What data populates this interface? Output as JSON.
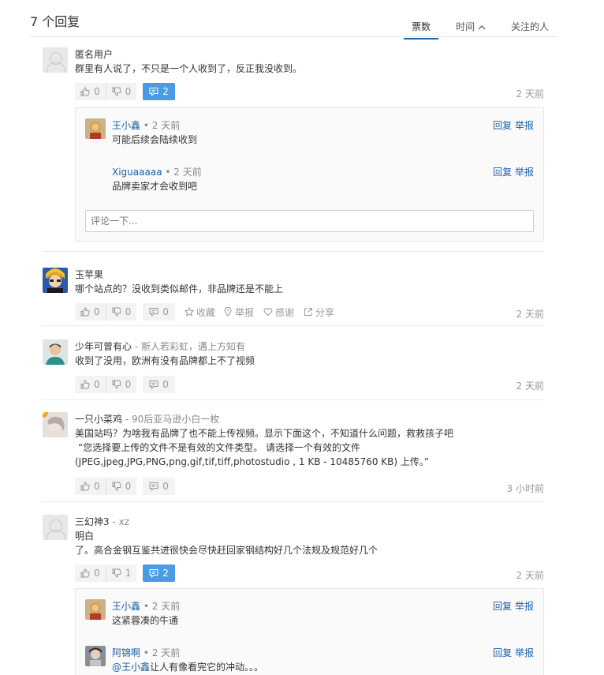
{
  "header": {
    "count_label": "7 个回复",
    "sort_tabs": [
      {
        "label": "票数",
        "active": true
      },
      {
        "label": "时间",
        "active": false
      },
      {
        "label": "关注的人",
        "active": false
      }
    ]
  },
  "answers": [
    {
      "user": "匿名用户",
      "title": "",
      "lines": [
        "群里有人说了，不只是一个人收到了，反正我没收到。"
      ],
      "up": "0",
      "down": "0",
      "comments": "2",
      "time": "2 天前",
      "comment_list": [
        {
          "user": "王小鑫",
          "time": "2 天前",
          "text": "可能后续会陆续收到",
          "reply": "回复",
          "report": "举报"
        },
        {
          "user": "Xiguaaaaa",
          "time": "2 天前",
          "text": "品牌卖家才会收到吧",
          "reply": "回复",
          "report": "举报"
        }
      ],
      "comment_placeholder": "评论一下..."
    },
    {
      "user": "玉苹果",
      "title": "",
      "lines": [
        "哪个站点的？没收到类似邮件，非品牌还是不能上"
      ],
      "up": "0",
      "down": "0",
      "comments": "0",
      "time": "2 天前",
      "extras": {
        "favorite": "收藏",
        "report": "举报",
        "thanks": "感谢",
        "share": "分享"
      }
    },
    {
      "user": "少年可曾有心",
      "title": "斯人若彩虹，遇上方知有",
      "lines": [
        "收到了没用，欧洲有没有品牌都上不了视频"
      ],
      "up": "0",
      "down": "0",
      "comments": "0",
      "time": "2 天前"
    },
    {
      "user": "一只小菜鸡",
      "title": "90后亚马逊小白一枚",
      "lines": [
        "美国站吗？为啥我有品牌了也不能上传视频。显示下面这个，不知道什么问题，救救孩子吧",
        "“您选择要上传的文件不是有效的文件类型。 请选择一个有效的文件",
        "(JPEG,jpeg,JPG,PNG,png,gif,tif,tiff,photostudio , 1 KB - 10485760 KB) 上传。”"
      ],
      "up": "0",
      "down": "0",
      "comments": "0",
      "time": "3 小时前"
    },
    {
      "user": "三幻神3",
      "title": "xz",
      "lines": [
        "明白",
        "了。高合金钢互鉴共进很快会尽快赶回家钢结构好几个法规及规范好几个"
      ],
      "up": "0",
      "down": "1",
      "comments": "2",
      "time": "2 天前",
      "comment_list": [
        {
          "user": "王小鑫",
          "time": "2 天前",
          "text": "这紧蓉凑的牛通",
          "reply": "回复",
          "report": "举报"
        },
        {
          "user": "阿锦啊",
          "time": "2 天前",
          "mention": "@王小鑫",
          "text": "让人有像看完它的冲动。。。",
          "reply": "回复",
          "report": "举报"
        }
      ]
    }
  ],
  "colors": {
    "accent": "#1c5fa8",
    "comment_active": "#4a9be6",
    "badge": "#f5a623"
  }
}
